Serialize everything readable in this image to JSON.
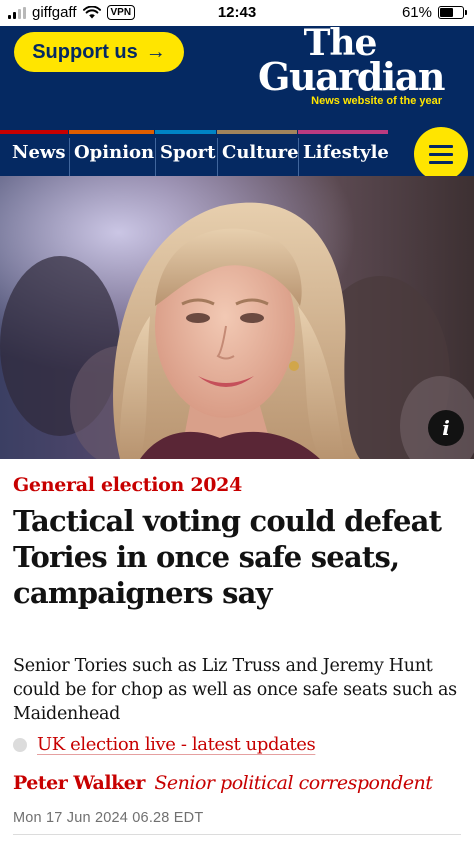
{
  "status_bar": {
    "carrier": "giffgaff",
    "vpn": "VPN",
    "time": "12:43",
    "battery": "61%",
    "battery_level": 0.61
  },
  "header": {
    "support_label": "Support us",
    "support_arrow": "→",
    "logo_the": "The",
    "logo_guardian": "Guardian",
    "logo_tagline": "News website of the year",
    "colors": {
      "brand_blue": "#052962",
      "yellow": "#ffe500"
    }
  },
  "nav": {
    "items": [
      {
        "label": "News",
        "color": "#c70000"
      },
      {
        "label": "Opinion",
        "color": "#e05e00"
      },
      {
        "label": "Sport",
        "color": "#0084c6"
      },
      {
        "label": "Culture",
        "color": "#a1845c"
      },
      {
        "label": "Lifestyle",
        "color": "#bb3b80"
      }
    ],
    "menu_icon": "hamburger-icon"
  },
  "hero": {
    "info_label": "i",
    "info_icon": "info-icon"
  },
  "article": {
    "kicker": "General election 2024",
    "headline": "Tactical voting could defeat Tories in once safe seats, campaigners say",
    "standfirst": "Senior Tories such as Liz Truss and Jeremy Hunt could be for chop as well as once safe seats such as Maidenhead",
    "live_link": "UK election live - latest updates",
    "author": "Peter Walker",
    "author_role": "Senior political correspondent",
    "date": "Mon 17 Jun 2024 06.28 EDT",
    "accent": "#c70000"
  }
}
